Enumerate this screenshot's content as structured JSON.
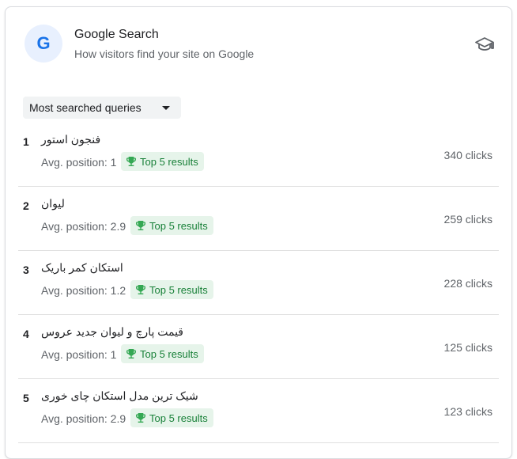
{
  "header": {
    "logo_letter": "G",
    "title": "Google Search",
    "subtitle": "How visitors find your site on Google",
    "cap_icon": "graduation-cap-icon"
  },
  "dropdown": {
    "label": "Most searched queries"
  },
  "badge_label": "Top 5 results",
  "colors": {
    "accent": "#1a73e8",
    "badge_bg": "#e6f4ea",
    "badge_text": "#188038"
  },
  "rows": [
    {
      "rank": "1",
      "query": "فنجون استور",
      "avg": "Avg. position: 1",
      "badge": "Top 5 results",
      "clicks": "340 clicks"
    },
    {
      "rank": "2",
      "query": "لیوان",
      "avg": "Avg. position: 2.9",
      "badge": "Top 5 results",
      "clicks": "259 clicks"
    },
    {
      "rank": "3",
      "query": "استکان کمر باریک",
      "avg": "Avg. position: 1.2",
      "badge": "Top 5 results",
      "clicks": "228 clicks"
    },
    {
      "rank": "4",
      "query": "قیمت پارچ و لیوان جدید عروس",
      "avg": "Avg. position: 1",
      "badge": "Top 5 results",
      "clicks": "125 clicks"
    },
    {
      "rank": "5",
      "query": "شیک ترین مدل استکان چای خوری",
      "avg": "Avg. position: 2.9",
      "badge": "Top 5 results",
      "clicks": "123 clicks"
    }
  ]
}
